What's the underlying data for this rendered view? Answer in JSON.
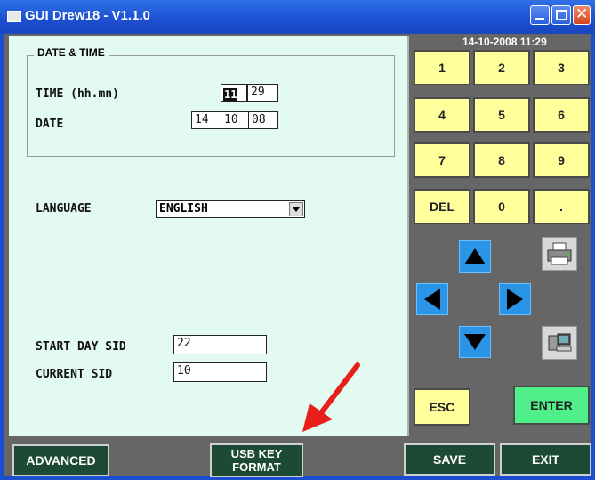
{
  "window": {
    "title": "GUI Drew18 - V1.1.0"
  },
  "clock": "14-10-2008 11:29",
  "date_time": {
    "group_label": "DATE & TIME",
    "time_label": "TIME (hh.mn)",
    "time_hh": "11",
    "time_mm": "29",
    "date_label": "DATE",
    "date_dd": "14",
    "date_mm": "10",
    "date_yy": "08"
  },
  "language": {
    "label": "LANGUAGE",
    "value": "ENGLISH"
  },
  "sid": {
    "start_label": "START DAY SID",
    "start_value": "22",
    "current_label": "CURRENT SID",
    "current_value": "10"
  },
  "keypad": {
    "k1": "1",
    "k2": "2",
    "k3": "3",
    "k4": "4",
    "k5": "5",
    "k6": "6",
    "k7": "7",
    "k8": "8",
    "k9": "9",
    "del": "DEL",
    "k0": "0",
    "dot": ".",
    "esc": "ESC",
    "enter": "ENTER"
  },
  "bottom": {
    "advanced": "ADVANCED",
    "usb_line1": "USB KEY",
    "usb_line2": "FORMAT",
    "save": "SAVE",
    "exit": "EXIT"
  },
  "colors": {
    "accent_arrow": "#e8201c",
    "keypad_yellow": "#ffff9c",
    "enter_green": "#4ff08a",
    "panel": "#e3faf0"
  }
}
